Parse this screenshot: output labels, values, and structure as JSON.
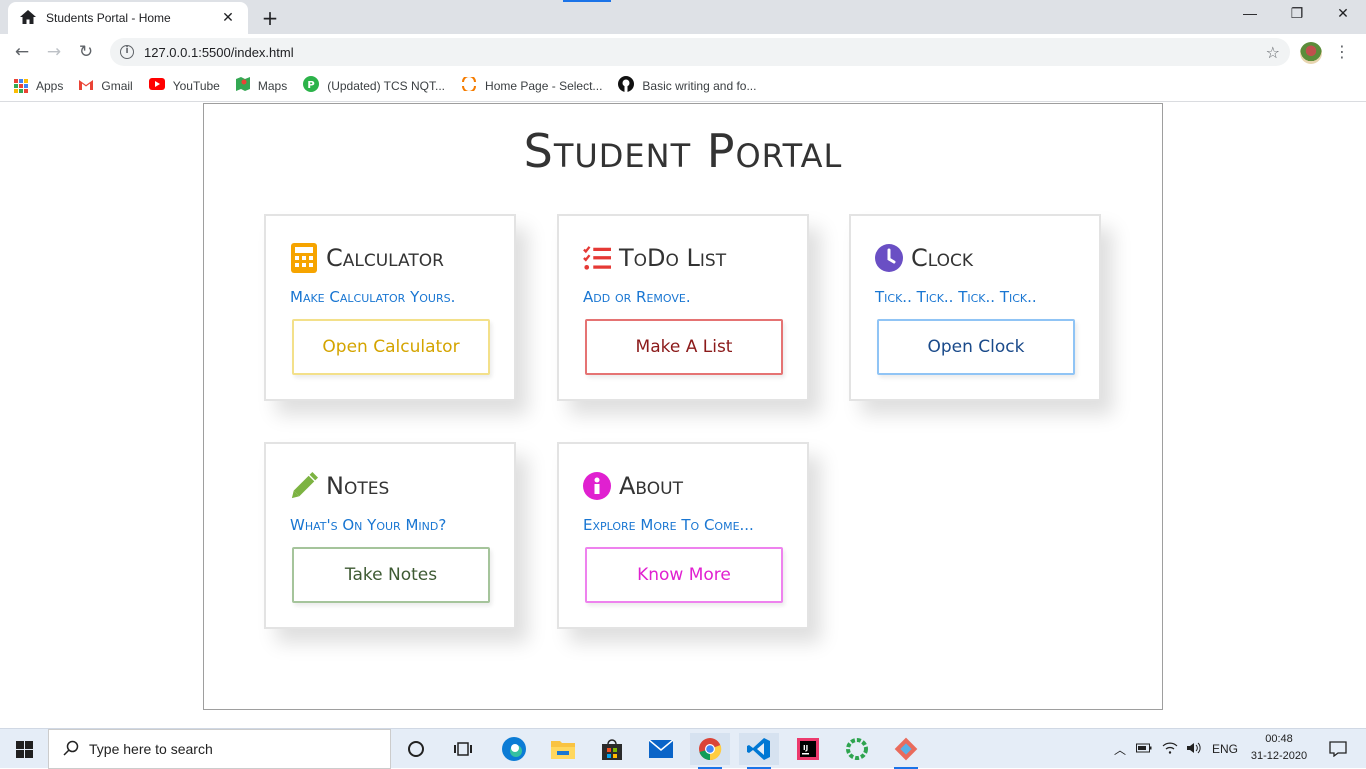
{
  "browser": {
    "tab_title": "Students Portal - Home",
    "url": "127.0.0.1:5500/index.html",
    "bookmarks": [
      {
        "label": "Apps",
        "icon": "apps-grid-icon"
      },
      {
        "label": "Gmail",
        "icon": "gmail-icon"
      },
      {
        "label": "YouTube",
        "icon": "youtube-icon"
      },
      {
        "label": "Maps",
        "icon": "maps-icon"
      },
      {
        "label": "(Updated) TCS NQT...",
        "icon": "prepinsta-icon"
      },
      {
        "label": "Home Page - Select...",
        "icon": "select-icon"
      },
      {
        "label": "Basic writing and fo...",
        "icon": "github-icon"
      }
    ]
  },
  "portal": {
    "title": "Student Portal",
    "cards": [
      {
        "title": "Calculator",
        "subtitle": "Make Calculator Yours.",
        "button": "Open Calculator",
        "icon": "calculator-icon",
        "color": "#f6a400"
      },
      {
        "title": "ToDo List",
        "subtitle": "Add or Remove.",
        "button": "Make A List",
        "icon": "checklist-icon",
        "color": "#e53935"
      },
      {
        "title": "Clock",
        "subtitle": "Tick.. Tick.. Tick.. Tick..",
        "button": "Open Clock",
        "icon": "clock-icon",
        "color": "#1565c0"
      },
      {
        "title": "Notes",
        "subtitle": "What's On Your Mind?",
        "button": "Take Notes",
        "icon": "pencil-icon",
        "color": "#7cb342"
      },
      {
        "title": "About",
        "subtitle": "Explore More To Come...",
        "button": "Know More",
        "icon": "info-icon",
        "color": "#e020d0"
      }
    ]
  },
  "taskbar": {
    "search_placeholder": "Type here to search",
    "language": "ENG",
    "time": "00:48",
    "date": "31-12-2020"
  }
}
